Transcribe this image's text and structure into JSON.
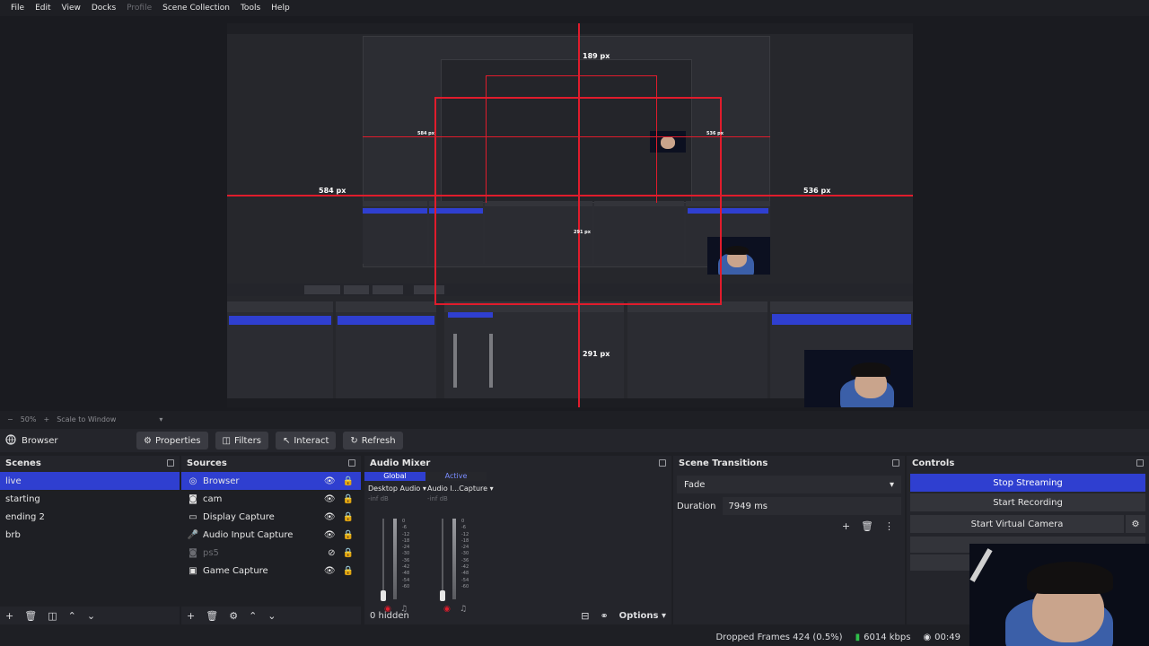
{
  "menu": {
    "items": [
      "File",
      "Edit",
      "View",
      "Docks",
      "Profile",
      "Scene Collection",
      "Tools",
      "Help"
    ]
  },
  "preview": {
    "measure_top": "189 px",
    "measure_left": "584 px",
    "measure_right": "536 px",
    "measure_bottom": "291 px",
    "inner_measure_left": "584 px",
    "inner_measure_right": "536 px",
    "inner_measure_bottom": "291 px"
  },
  "zoom": {
    "minus": "−",
    "value": "50%",
    "plus": "+",
    "mode": "Scale to Window"
  },
  "source_toolbar": {
    "source_name": "Browser",
    "properties": "Properties",
    "filters": "Filters",
    "interact": "Interact",
    "refresh": "Refresh"
  },
  "scenes": {
    "title": "Scenes",
    "items": [
      "live",
      "starting",
      "ending 2",
      "brb"
    ],
    "selected": "live"
  },
  "sources": {
    "title": "Sources",
    "items": [
      {
        "name": "Browser",
        "icon": "browser-icon"
      },
      {
        "name": "cam",
        "icon": "camera-icon"
      },
      {
        "name": "Display Capture",
        "icon": "monitor-icon"
      },
      {
        "name": "Audio Input Capture",
        "icon": "microphone-icon"
      },
      {
        "name": "ps5",
        "icon": "camera-icon"
      },
      {
        "name": "Game Capture",
        "icon": "gamepad-icon"
      }
    ]
  },
  "mixer": {
    "title": "Audio Mixer",
    "tab_global": "Global",
    "tab_active": "Active",
    "channels": [
      {
        "name": "Desktop Audio",
        "db": "-inf dB"
      },
      {
        "name": "Audio I...Capture",
        "db": "-inf dB"
      }
    ],
    "ticks": [
      "0",
      "-6",
      "-12",
      "-18",
      "-24",
      "-30",
      "-36",
      "-42",
      "-48",
      "-54",
      "-60"
    ],
    "hidden": "0 hidden",
    "options": "Options"
  },
  "transitions": {
    "title": "Scene Transitions",
    "type": "Fade",
    "duration_label": "Duration",
    "duration_value": "7949 ms"
  },
  "controls": {
    "title": "Controls",
    "stop_streaming": "Stop Streaming",
    "start_recording": "Start Recording",
    "start_virtual_camera": "Start Virtual Camera"
  },
  "status": {
    "dropped": "Dropped Frames 424 (0.5%)",
    "bitrate": "6014 kbps",
    "time": "00:49"
  },
  "colors": {
    "accent": "#2f3fd0",
    "guide_red": "#e01c2c",
    "bitrate_green": "#2fbf4a"
  }
}
